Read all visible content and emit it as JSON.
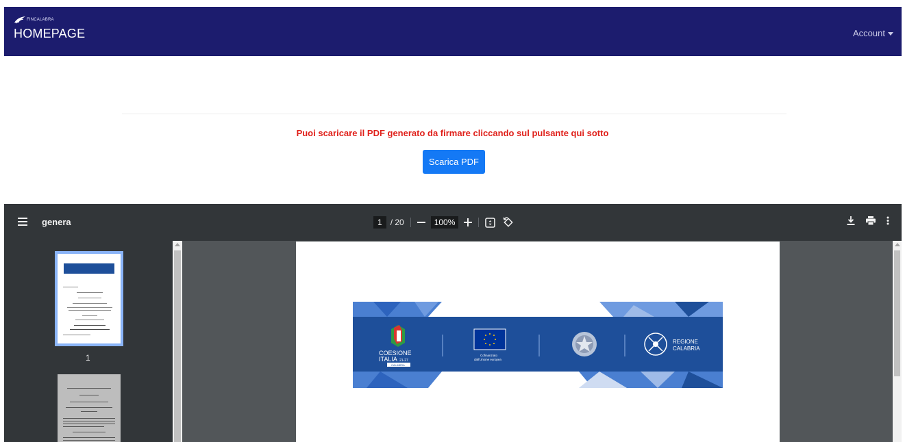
{
  "navbar": {
    "logo_text": "FINCALABRA",
    "title": "HOMEPAGE",
    "account_label": "Account"
  },
  "main": {
    "notice": "Puoi scaricare il PDF generato da firmare cliccando sul pulsante qui sotto",
    "download_button": "Scarica PDF"
  },
  "pdf_viewer": {
    "file_title": "genera",
    "current_page": "1",
    "page_total": "/ 20",
    "zoom": "100%",
    "thumbnail_label": "1",
    "icons": {
      "menu": "hamburger-menu-icon",
      "zoom_out": "minus-icon",
      "zoom_in": "plus-icon",
      "fit": "fit-page-icon",
      "rotate": "rotate-icon",
      "download": "download-icon",
      "print": "printer-icon",
      "more": "more-vert-icon"
    }
  },
  "banner": {
    "coesione_line1": "COESIONE",
    "coesione_line2": "ITALIA",
    "coesione_years": "21-27",
    "coesione_region": "CALABRIA",
    "eu_line1": "Cofinanziato",
    "eu_line2": "dall'Unione europea",
    "regione_line1": "REGIONE",
    "regione_line2": "CALABRIA"
  },
  "colors": {
    "navbar": "#1c1c6e",
    "button": "#1479f5",
    "notice": "#e0201a",
    "viewer_toolbar": "#323639",
    "viewer_bg": "#525659",
    "banner_blue": "#1e4f9a"
  }
}
